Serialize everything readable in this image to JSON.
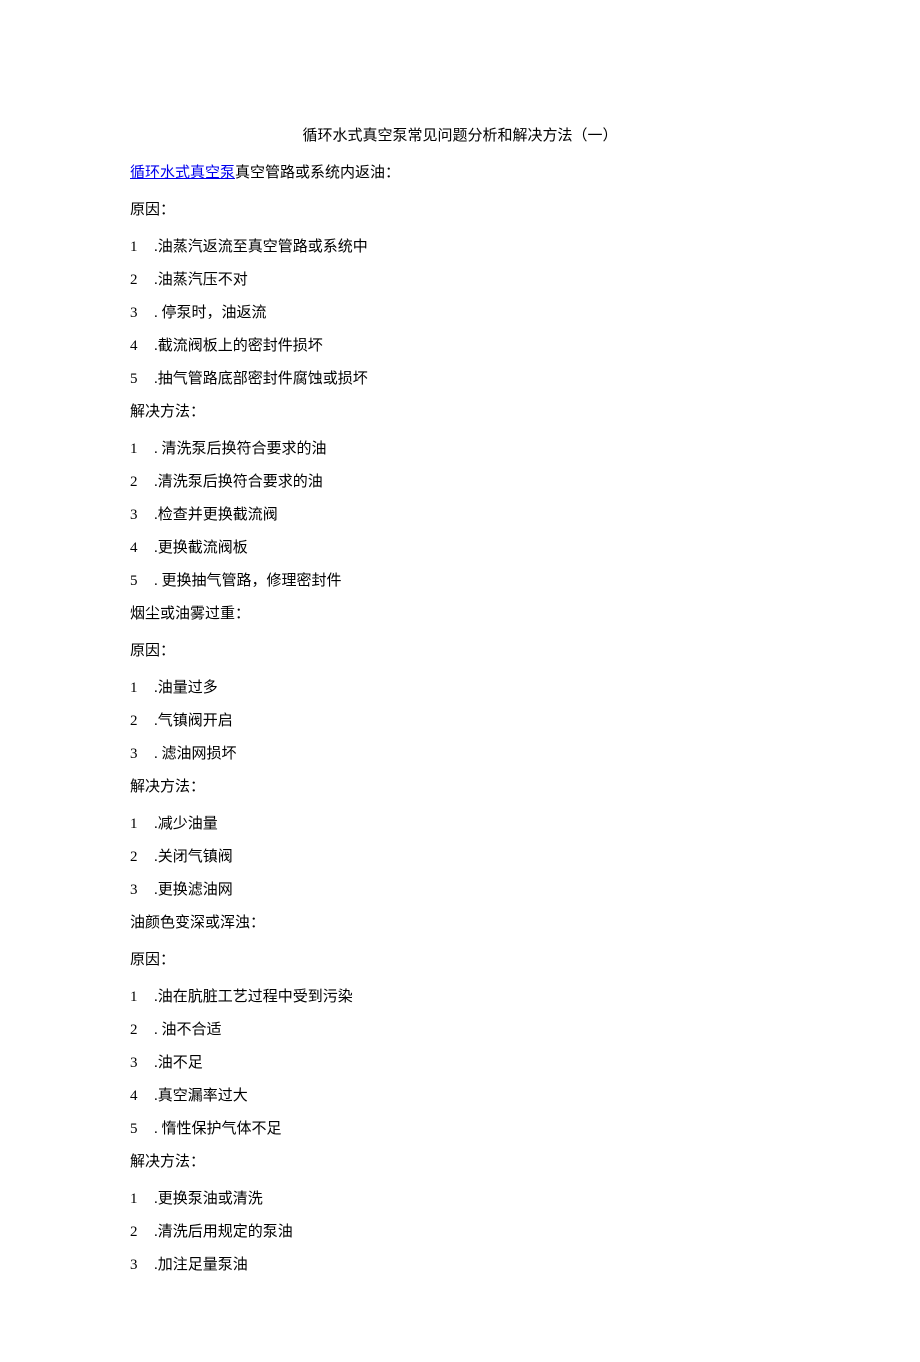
{
  "title": "循环水式真空泵常见问题分析和解决方法（一）",
  "intro_link": "循环水式真空泵",
  "intro_rest": "真空管路或系统内返油：",
  "labels": {
    "cause": "原因：",
    "solution": "解决方法："
  },
  "sections": [
    {
      "causes": [
        "油蒸汽返流至真空管路或系统中",
        "油蒸汽压不对",
        "停泵时，油返流",
        "截流阀板上的密封件损坏",
        "抽气管路底部密封件腐蚀或损坏"
      ],
      "solutions": [
        "清洗泵后换符合要求的油",
        "清洗泵后换符合要求的油",
        "检查并更换截流阀",
        "更换截流阀板",
        "更换抽气管路，修理密封件"
      ]
    },
    {
      "heading": "烟尘或油雾过重：",
      "causes": [
        "油量过多",
        "气镇阀开启",
        "滤油网损坏"
      ],
      "solutions": [
        "减少油量",
        "关闭气镇阀",
        "更换滤油网"
      ]
    },
    {
      "heading": "油颜色变深或浑浊：",
      "causes": [
        "油在肮脏工艺过程中受到污染",
        "油不合适",
        "油不足",
        "真空漏率过大",
        "惰性保护气体不足"
      ],
      "solutions": [
        "更换泵油或清洗",
        "清洗后用规定的泵油",
        "加注足量泵油"
      ]
    }
  ],
  "spaced_indices": {
    "0": {
      "causes": [
        2
      ],
      "solutions": [
        0,
        4
      ]
    },
    "1": {
      "causes": [
        2
      ],
      "solutions": []
    },
    "2": {
      "causes": [
        1,
        4
      ],
      "solutions": []
    }
  }
}
